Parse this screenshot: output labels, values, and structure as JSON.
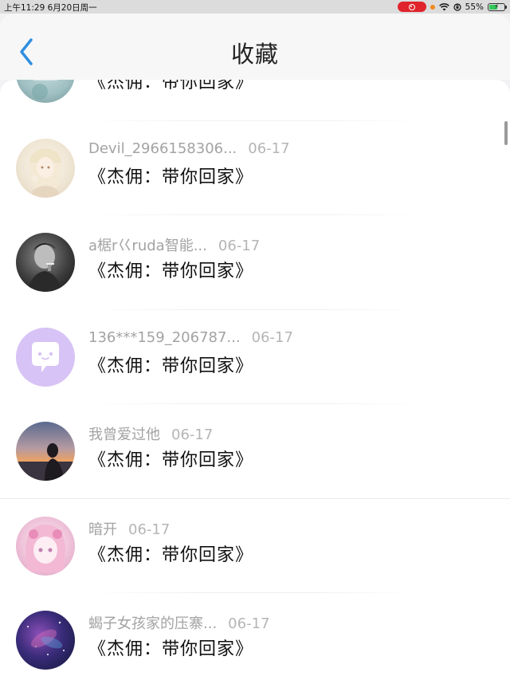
{
  "status_bar": {
    "time_date": "上午11:29   6月20日周一",
    "battery_percent": "55%",
    "battery_level": 0.55
  },
  "header": {
    "title": "收藏",
    "back_icon": "chevron-left-icon",
    "accent_color": "#2f8fe0"
  },
  "items": [
    {
      "name": "",
      "date": "",
      "content": "《杰佣：带你回家》"
    },
    {
      "name": "Devil_2966158306...",
      "date": "06-17",
      "content": "《杰佣：带你回家》"
    },
    {
      "name": "a椐r巜ruda智能...",
      "date": "06-17",
      "content": "《杰佣：带你回家》"
    },
    {
      "name": "136***159_206787...",
      "date": "06-17",
      "content": "《杰佣：带你回家》"
    },
    {
      "name": "我曾爱过他",
      "date": "06-17",
      "content": "《杰佣：带你回家》"
    },
    {
      "name": "暗开",
      "date": "06-17",
      "content": "《杰佣：带你回家》"
    },
    {
      "name": "蝎子女孩家的压寨...",
      "date": "06-17",
      "content": "《杰佣：带你回家》"
    }
  ]
}
